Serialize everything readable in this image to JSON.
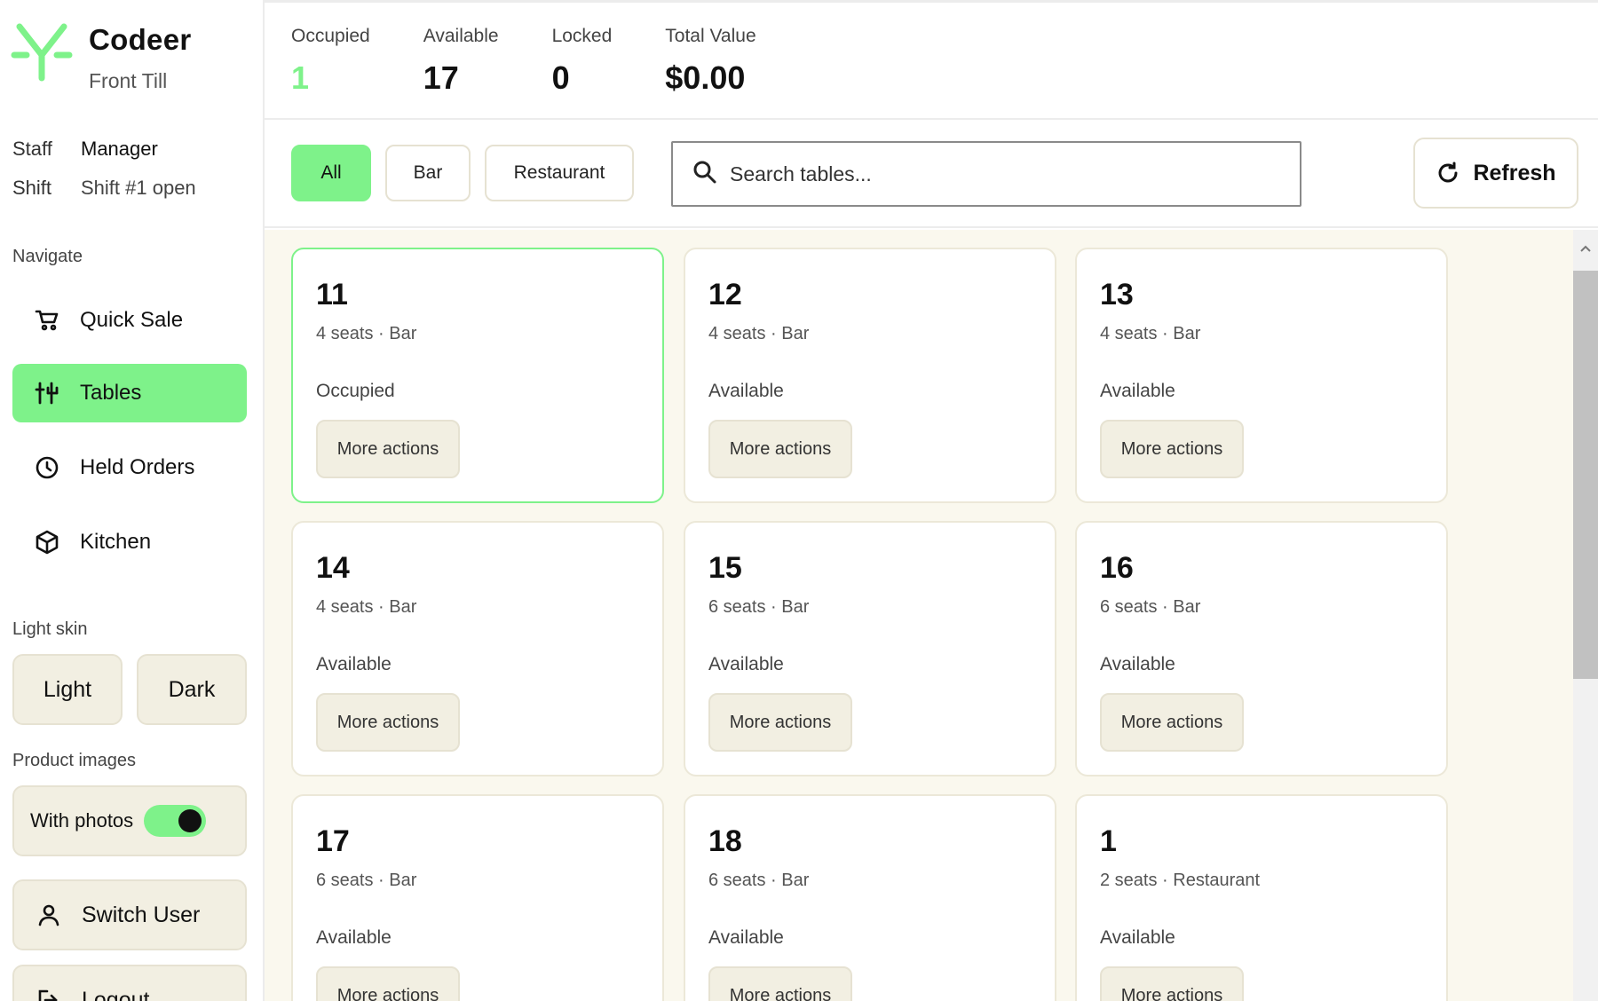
{
  "brand": {
    "name": "Codeer",
    "subtitle": "Front Till",
    "accent": "#7ef28a"
  },
  "session": {
    "staff_label": "Staff",
    "staff_value": "Manager",
    "shift_label": "Shift",
    "shift_value": "Shift #1 open"
  },
  "nav": {
    "label": "Navigate",
    "items": [
      {
        "label": "Quick Sale",
        "icon": "cart-icon",
        "active": false
      },
      {
        "label": "Tables",
        "icon": "utensils-icon",
        "active": true
      },
      {
        "label": "Held Orders",
        "icon": "clock-icon",
        "active": false
      },
      {
        "label": "Kitchen",
        "icon": "box-icon",
        "active": false
      }
    ]
  },
  "skin": {
    "label": "Light skin",
    "light": "Light",
    "dark": "Dark"
  },
  "product_images": {
    "label": "Product images",
    "toggle_label": "With photos",
    "enabled": true
  },
  "actions": {
    "switch_user": "Switch User",
    "logout": "Logout"
  },
  "stats": [
    {
      "label": "Occupied",
      "value": "1"
    },
    {
      "label": "Available",
      "value": "17"
    },
    {
      "label": "Locked",
      "value": "0"
    },
    {
      "label": "Total Value",
      "value": "$0.00"
    }
  ],
  "filters": [
    "All",
    "Bar",
    "Restaurant"
  ],
  "active_filter": "All",
  "search": {
    "placeholder": "Search tables..."
  },
  "refresh_label": "Refresh",
  "tables": [
    {
      "number": "11",
      "seats": "4 seats · Bar",
      "status": "Occupied",
      "action": "More actions"
    },
    {
      "number": "12",
      "seats": "4 seats · Bar",
      "status": "Available",
      "action": "More actions"
    },
    {
      "number": "13",
      "seats": "4 seats · Bar",
      "status": "Available",
      "action": "More actions"
    },
    {
      "number": "14",
      "seats": "4 seats · Bar",
      "status": "Available",
      "action": "More actions"
    },
    {
      "number": "15",
      "seats": "6 seats · Bar",
      "status": "Available",
      "action": "More actions"
    },
    {
      "number": "16",
      "seats": "6 seats · Bar",
      "status": "Available",
      "action": "More actions"
    },
    {
      "number": "17",
      "seats": "6 seats · Bar",
      "status": "Available",
      "action": "More actions"
    },
    {
      "number": "18",
      "seats": "6 seats · Bar",
      "status": "Available",
      "action": "More actions"
    },
    {
      "number": "1",
      "seats": "2 seats · Restaurant",
      "status": "Available",
      "action": "More actions"
    }
  ]
}
